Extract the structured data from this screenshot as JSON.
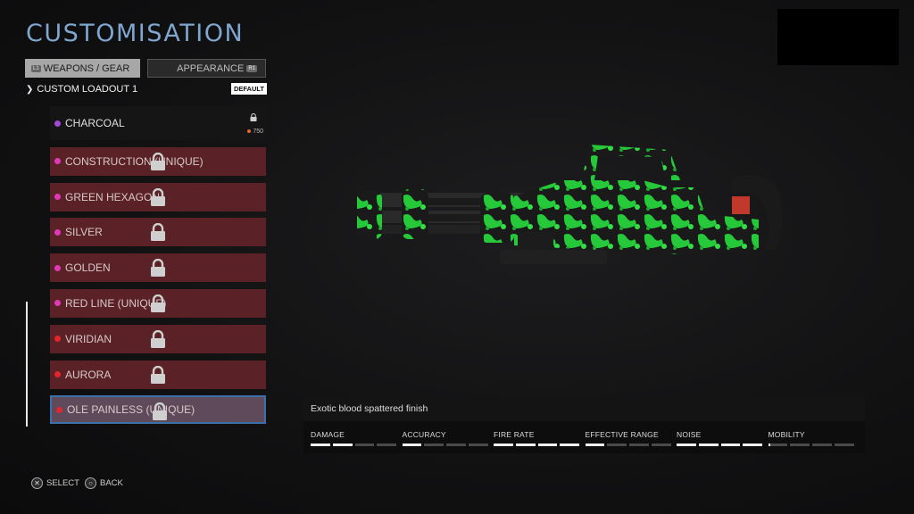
{
  "header": {
    "title": "CUSTOMISATION"
  },
  "tabs": [
    {
      "label": "WEAPONS / GEAR",
      "hint": "L1"
    },
    {
      "label": "APPEARANCE",
      "hint": "R1"
    }
  ],
  "loadout": {
    "name": "CUSTOM LOADOUT 1",
    "badge": "DEFAULT"
  },
  "skins": [
    {
      "name": "CHARCOAL",
      "dot": "#a24ad6",
      "price": "750",
      "selected": false
    },
    {
      "name": "CONSTRUCTION (UNIQUE)",
      "dot": "#e03ab8",
      "selected": false
    },
    {
      "name": "GREEN HEXAGON",
      "dot": "#e03ab8",
      "selected": false
    },
    {
      "name": "SILVER",
      "dot": "#e03ab8",
      "selected": false
    },
    {
      "name": "GOLDEN",
      "dot": "#e03ab8",
      "selected": false
    },
    {
      "name": "RED LINE (UNIQUE)",
      "dot": "#e03ab8",
      "selected": false
    },
    {
      "name": "VIRIDIAN",
      "dot": "#e3262c",
      "selected": false
    },
    {
      "name": "AURORA",
      "dot": "#e3262c",
      "selected": false
    },
    {
      "name": "OLE PAINLESS (UNIQUE)",
      "dot": "#e3262c",
      "selected": true
    }
  ],
  "details": {
    "description": "Exotic blood spattered finish",
    "stats": [
      {
        "label": "DAMAGE",
        "filled": 2,
        "total": 4
      },
      {
        "label": "ACCURACY",
        "filled": 1,
        "total": 4
      },
      {
        "label": "FIRE RATE",
        "filled": 4,
        "total": 4
      },
      {
        "label": "EFFECTIVE RANGE",
        "filled": 1,
        "total": 4
      },
      {
        "label": "NOISE",
        "filled": 4,
        "total": 4
      },
      {
        "label": "MOBILITY",
        "filled": 0.1,
        "total": 4
      }
    ]
  },
  "footer": {
    "select": {
      "icon": "✕",
      "label": "SELECT"
    },
    "back": {
      "icon": "○",
      "label": "BACK"
    }
  },
  "colors": {
    "accent": "#7fa6cf",
    "locked_row": "#5a2226",
    "selected_border": "#3d6fa8",
    "skin_green": "#27d83a"
  }
}
